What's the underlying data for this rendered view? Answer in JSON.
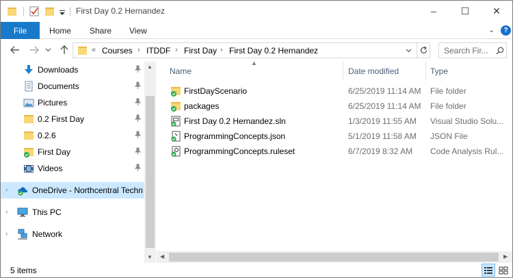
{
  "window": {
    "title": "First Day 0.2 Hernandez",
    "controls": {
      "minimize": "─",
      "maximize": "☐",
      "close": "✕"
    }
  },
  "ribbon": {
    "file_tab": "File",
    "tabs": [
      "Home",
      "Share",
      "View"
    ],
    "expand_glyph": "⌄",
    "help_glyph": "?"
  },
  "address": {
    "overflow": "«",
    "breadcrumbs": [
      "Courses",
      "ITDDF",
      "First Day",
      "First Day 0.2 Hernandez"
    ]
  },
  "search": {
    "placeholder": "Search Fir..."
  },
  "nav": {
    "quick_access": [
      {
        "label": "Downloads",
        "icon": "download-icon",
        "pinned": true
      },
      {
        "label": "Documents",
        "icon": "documents-icon",
        "pinned": true
      },
      {
        "label": "Pictures",
        "icon": "pictures-icon",
        "pinned": true
      },
      {
        "label": "0.2 First Day",
        "icon": "folder-icon",
        "pinned": true
      },
      {
        "label": "0.2.6",
        "icon": "folder-icon",
        "pinned": true
      },
      {
        "label": "First Day",
        "icon": "synced-folder-icon",
        "pinned": true
      },
      {
        "label": "Videos",
        "icon": "videos-icon",
        "pinned": true
      }
    ],
    "roots": [
      {
        "label": "OneDrive - Northcentral Techn",
        "icon": "onedrive-icon",
        "selected": true
      },
      {
        "label": "This PC",
        "icon": "pc-icon",
        "selected": false
      },
      {
        "label": "Network",
        "icon": "network-icon",
        "selected": false
      }
    ]
  },
  "columns": {
    "name": "Name",
    "date": "Date modified",
    "type": "Type"
  },
  "files": [
    {
      "name": "FirstDayScenario",
      "date": "6/25/2019 11:14 AM",
      "type": "File folder",
      "icon": "synced-folder-icon"
    },
    {
      "name": "packages",
      "date": "6/25/2019 11:14 AM",
      "type": "File folder",
      "icon": "synced-folder-icon"
    },
    {
      "name": "First Day 0.2 Hernandez.sln",
      "date": "1/3/2019 11:55 AM",
      "type": "Visual Studio Solu...",
      "icon": "solution-file-icon"
    },
    {
      "name": "ProgrammingConcepts.json",
      "date": "5/1/2019 11:58 AM",
      "type": "JSON File",
      "icon": "json-file-icon"
    },
    {
      "name": "ProgrammingConcepts.ruleset",
      "date": "6/7/2019 8:32 AM",
      "type": "Code Analysis Rul...",
      "icon": "ruleset-file-icon"
    }
  ],
  "status": {
    "item_count": "5 items"
  },
  "colors": {
    "accent": "#1979ca",
    "selected": "#cce8ff",
    "folder": "#f8d775",
    "sync_green": "#2fa84f",
    "onedrive": "#0f6cbd"
  }
}
